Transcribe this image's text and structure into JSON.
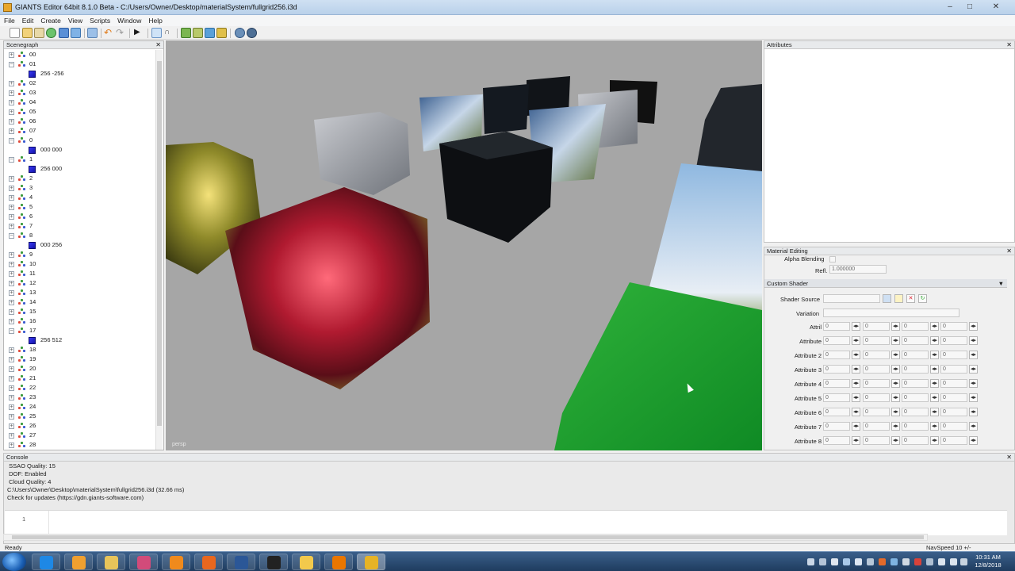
{
  "window": {
    "title": "GIANTS Editor 64bit 8.1.0 Beta - C:/Users/Owner/Desktop/materialSystem/fullgrid256.i3d",
    "minimize": "–",
    "maximize": "□",
    "close": "✕"
  },
  "menu": [
    "File",
    "Edit",
    "Create",
    "View",
    "Scripts",
    "Window",
    "Help"
  ],
  "toolbar": {
    "icons": [
      "new-icon",
      "open-icon",
      "save-icon",
      "reload-icon",
      "save-all-icon",
      "export-icon",
      "cut-icon",
      "undo-icon",
      "redo-icon",
      "play-icon",
      "select-icon",
      "magnet-icon",
      "terrain-paint-icon",
      "terrain-sculpt-icon",
      "foliage-paint-icon",
      "place-object-icon",
      "settings-icon",
      "settings-alt-icon"
    ]
  },
  "scenegraph": {
    "title": "Scenegraph",
    "rows": [
      {
        "label": "00",
        "expanded": false,
        "child": false
      },
      {
        "label": "01",
        "expanded": true,
        "child": false
      },
      {
        "label": "256 -256",
        "child": true
      },
      {
        "label": "02",
        "expanded": false,
        "child": false
      },
      {
        "label": "03",
        "expanded": false,
        "child": false
      },
      {
        "label": "04",
        "expanded": false,
        "child": false
      },
      {
        "label": "05",
        "expanded": false,
        "child": false
      },
      {
        "label": "06",
        "expanded": false,
        "child": false
      },
      {
        "label": "07",
        "expanded": false,
        "child": false
      },
      {
        "label": "0",
        "expanded": true,
        "child": false
      },
      {
        "label": "000 000",
        "child": true
      },
      {
        "label": "1",
        "expanded": true,
        "child": false
      },
      {
        "label": "256 000",
        "child": true
      },
      {
        "label": "2",
        "expanded": false,
        "child": false
      },
      {
        "label": "3",
        "expanded": false,
        "child": false
      },
      {
        "label": "4",
        "expanded": false,
        "child": false
      },
      {
        "label": "5",
        "expanded": false,
        "child": false
      },
      {
        "label": "6",
        "expanded": false,
        "child": false
      },
      {
        "label": "7",
        "expanded": false,
        "child": false
      },
      {
        "label": "8",
        "expanded": true,
        "child": false
      },
      {
        "label": "000 256",
        "child": true
      },
      {
        "label": "9",
        "expanded": false,
        "child": false
      },
      {
        "label": "10",
        "expanded": false,
        "child": false
      },
      {
        "label": "11",
        "expanded": false,
        "child": false
      },
      {
        "label": "12",
        "expanded": false,
        "child": false
      },
      {
        "label": "13",
        "expanded": false,
        "child": false
      },
      {
        "label": "14",
        "expanded": false,
        "child": false
      },
      {
        "label": "15",
        "expanded": false,
        "child": false
      },
      {
        "label": "16",
        "expanded": false,
        "child": false
      },
      {
        "label": "17",
        "expanded": true,
        "child": false
      },
      {
        "label": "256 512",
        "child": true
      },
      {
        "label": "18",
        "expanded": false,
        "child": false
      },
      {
        "label": "19",
        "expanded": false,
        "child": false
      },
      {
        "label": "20",
        "expanded": false,
        "child": false
      },
      {
        "label": "21",
        "expanded": false,
        "child": false
      },
      {
        "label": "22",
        "expanded": false,
        "child": false
      },
      {
        "label": "23",
        "expanded": false,
        "child": false
      },
      {
        "label": "24",
        "expanded": false,
        "child": false
      },
      {
        "label": "25",
        "expanded": false,
        "child": false
      },
      {
        "label": "26",
        "expanded": false,
        "child": false
      },
      {
        "label": "27",
        "expanded": false,
        "child": false
      },
      {
        "label": "28",
        "expanded": false,
        "child": false
      }
    ]
  },
  "viewport": {
    "camera_label": "persp"
  },
  "attributes": {
    "title": "Attributes"
  },
  "material_editing": {
    "title": "Material Editing",
    "alpha_blending_label": "Alpha Blending",
    "refl_label": "Refl.",
    "refl_value": "1.000000",
    "custom_shader_label": "Custom Shader",
    "shader_source_label": "Shader Source",
    "shader_source_value": "",
    "variation_label": "Variation",
    "variation_value": "",
    "attributes": [
      {
        "label": "Attril",
        "values": [
          "0",
          "0",
          "0",
          "0"
        ]
      },
      {
        "label": "Attribute",
        "values": [
          "0",
          "0",
          "0",
          "0"
        ]
      },
      {
        "label": "Attribute 2",
        "values": [
          "0",
          "0",
          "0",
          "0"
        ]
      },
      {
        "label": "Attribute 3",
        "values": [
          "0",
          "0",
          "0",
          "0"
        ]
      },
      {
        "label": "Attribute 4",
        "values": [
          "0",
          "0",
          "0",
          "0"
        ]
      },
      {
        "label": "Attribute 5",
        "values": [
          "0",
          "0",
          "0",
          "0"
        ]
      },
      {
        "label": "Attribute 6",
        "values": [
          "0",
          "0",
          "0",
          "0"
        ]
      },
      {
        "label": "Attribute 7",
        "values": [
          "0",
          "0",
          "0",
          "0"
        ]
      },
      {
        "label": "Attribute 8",
        "values": [
          "0",
          "0",
          "0",
          "0"
        ]
      }
    ]
  },
  "console": {
    "title": "Console",
    "lines": [
      " SSAO Quality: 15",
      " DOF: Enabled",
      " Cloud Quality: 4",
      "C:\\Users\\Owner\\Desktop\\materialSystem\\fullgrid256.i3d (32.66 ms)",
      "Check for updates (https://gdn.giants-software.com)"
    ],
    "input_line_number": "1"
  },
  "status": {
    "left": "Ready",
    "right": "NavSpeed 10 +/-"
  },
  "taskbar": {
    "apps": [
      {
        "name": "internet-explorer-icon",
        "color": "#1e88e5"
      },
      {
        "name": "media-player-icon",
        "color": "#f0a030"
      },
      {
        "name": "file-explorer-icon",
        "color": "#e8c45a"
      },
      {
        "name": "paint-icon",
        "color": "#d24b7a"
      },
      {
        "name": "app-h-icon",
        "color": "#f08a1c"
      },
      {
        "name": "firefox-icon",
        "color": "#e8671e"
      },
      {
        "name": "word-icon",
        "color": "#2b5797"
      },
      {
        "name": "obs-icon",
        "color": "#222222"
      },
      {
        "name": "folder-icon",
        "color": "#f2c94c"
      },
      {
        "name": "blender-icon",
        "color": "#ea7600"
      },
      {
        "name": "giants-editor-icon",
        "color": "#e6b325"
      }
    ],
    "time": "10:31 AM",
    "date": "12/8/2018"
  }
}
